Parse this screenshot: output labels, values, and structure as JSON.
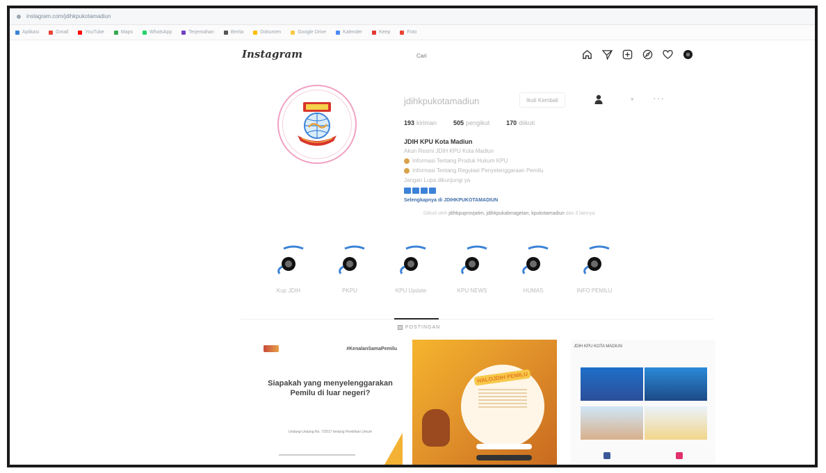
{
  "browser": {
    "url": "instagram.com/jdihkpukotamadiun",
    "bookmarks": [
      "Aplikasi",
      "Gmail",
      "YouTube",
      "Maps",
      "WhatsApp",
      "Terjemahan",
      "Berita",
      "Dokumen",
      "Google Drive",
      "Kalender",
      "Keep",
      "Foto"
    ]
  },
  "header": {
    "logo": "Instagram",
    "search_placeholder": "Cari",
    "nav_icons": [
      "home-icon",
      "direct-icon",
      "new-post-icon",
      "explore-icon",
      "activity-icon",
      "profile-icon"
    ]
  },
  "profile": {
    "username": "jdihkpukotamadiun",
    "follow_button": "Ikuti Kembali",
    "dropdown": "▾",
    "more": "···",
    "stats": {
      "posts_count": "193",
      "posts_label": "kiriman",
      "followers_count": "505",
      "followers_label": "pengikut",
      "following_count": "170",
      "following_label": "diikuti"
    },
    "bio": {
      "name": "JDIH KPU Kota Madiun",
      "category": "Akun Resmi JDIH KPU Kota Madiun",
      "line1": "Informasi Tentang Produk Hukum KPU",
      "line2": "Informasi Tentang Regulasi Penyelenggaraan Pemilu",
      "line3": "Jangan Lupa dikunjungi ya",
      "link": "Selengkapnya di JDIHKPUKOTAMADIUN",
      "followed_prefix": "Diikuti oleh",
      "followed_names": "jdihkpuprovjatim, jdihkpukabmagetan, kpukotamadiun",
      "followed_suffix": "dan 3 lainnya"
    }
  },
  "highlights": [
    {
      "label": "Kup JDIH"
    },
    {
      "label": "PKPU"
    },
    {
      "label": "KPU Update"
    },
    {
      "label": "KPU NEWS"
    },
    {
      "label": "HUMAS"
    },
    {
      "label": "INFO PEMILU"
    }
  ],
  "tabs": {
    "posts_label": "POSTINGAN"
  },
  "posts": {
    "post1": {
      "handle": "#KenalanSamaPemilu",
      "question": "Siapakah yang menyelenggarakan Pemilu di luar negeri?",
      "footer": "Undang-Undang No. 7/2017 tentang Pemilihan Umum"
    },
    "post2": {
      "title": "HALOJDIH PEMILU"
    },
    "post3": {
      "header": "JDIH KPU KOTA MADIUN"
    }
  },
  "colors": {
    "avatar_ring": "#f0a1c2",
    "link": "#3f6ea8",
    "highlight_arrow": "#3b82d8"
  }
}
